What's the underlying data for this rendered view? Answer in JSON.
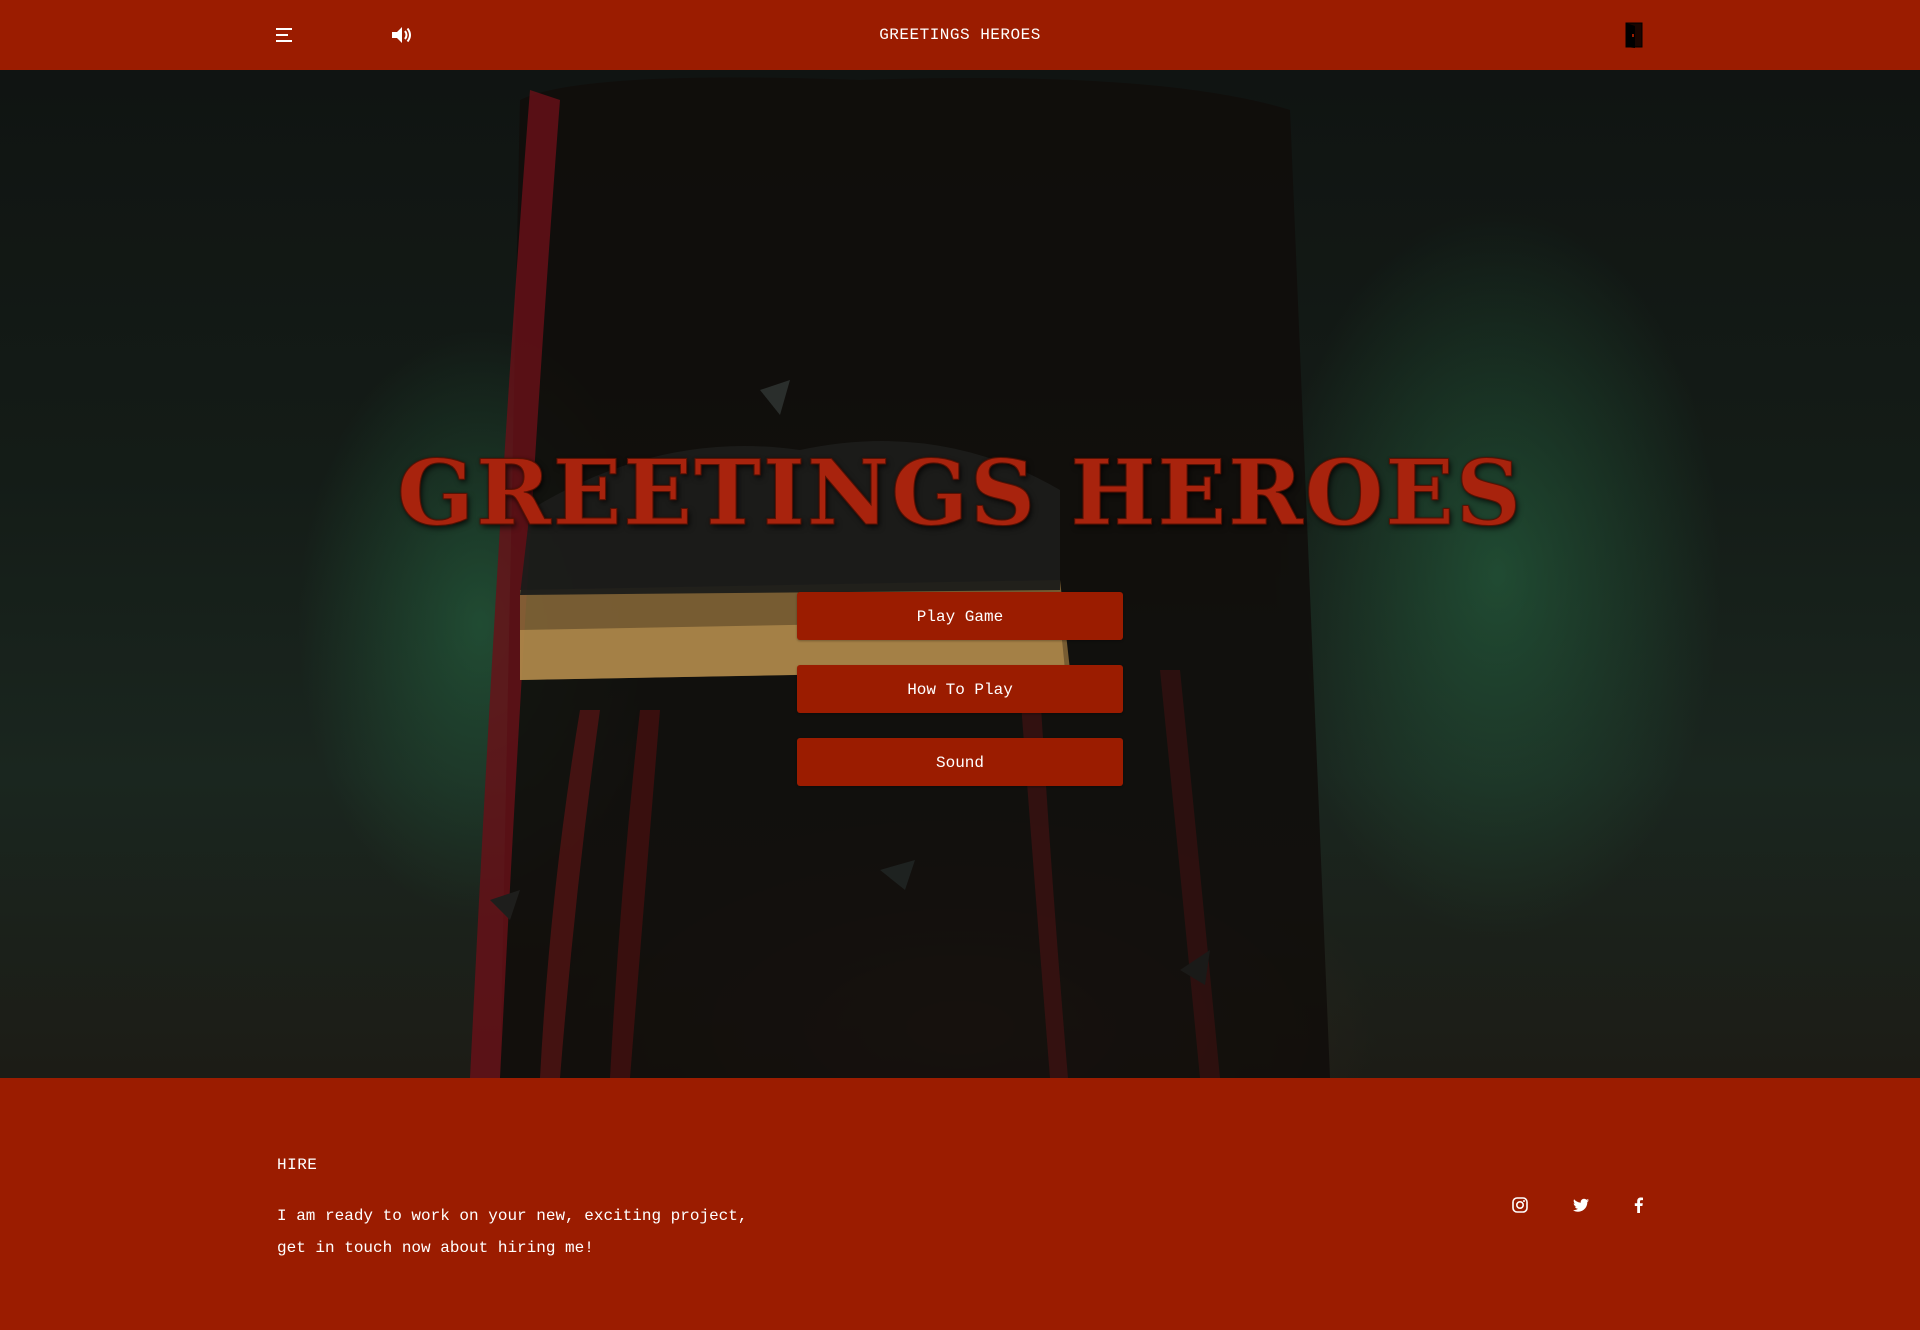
{
  "header": {
    "title": "GREETINGS HEROES",
    "menu_icon": "menu-icon",
    "sound_icon": "speaker-icon",
    "exit_icon": "exit-door-icon"
  },
  "hero": {
    "title": "GREETINGS HEROES",
    "buttons": {
      "play": "Play Game",
      "how_to": "How To Play",
      "sound": "Sound"
    }
  },
  "footer": {
    "heading": "HIRE",
    "text_line1": "I am ready to work on your new, exciting project,",
    "text_line2": "get in touch now about hiring me!",
    "social": [
      "instagram-icon",
      "twitter-icon",
      "facebook-icon"
    ]
  },
  "colors": {
    "brand": "#9b1c00",
    "title_red": "#a8230d",
    "text": "#ffffff"
  }
}
